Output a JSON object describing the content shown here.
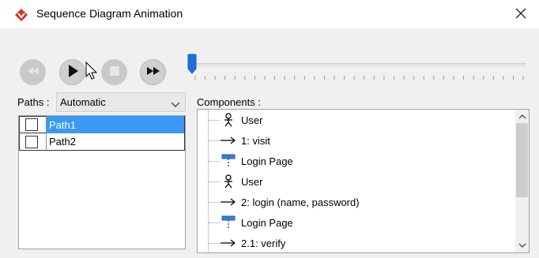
{
  "window": {
    "title": "Sequence Diagram Animation",
    "app_icon": "visual-paradigm-logo",
    "close_icon": "close-icon"
  },
  "controls": {
    "rewind": {
      "icon": "rewind-icon",
      "enabled": false
    },
    "play": {
      "icon": "play-icon",
      "enabled": true
    },
    "stop": {
      "icon": "stop-icon",
      "enabled": false
    },
    "fast_forward": {
      "icon": "fast-forward-icon",
      "enabled": true
    }
  },
  "timeline": {
    "position": 0.0,
    "tick_count": 34
  },
  "paths": {
    "label": "Paths :",
    "selected": "Automatic",
    "items": [
      {
        "label": "Path1",
        "checked": false,
        "selected": true
      },
      {
        "label": "Path2",
        "checked": false,
        "selected": false
      }
    ]
  },
  "components": {
    "label": "Components :",
    "items": [
      {
        "type": "actor",
        "icon": "actor-icon",
        "label": "User"
      },
      {
        "type": "message",
        "icon": "message-arrow-icon",
        "label": "1: visit"
      },
      {
        "type": "lifeline",
        "icon": "lifeline-icon",
        "label": "Login Page"
      },
      {
        "type": "actor",
        "icon": "actor-icon",
        "label": "User"
      },
      {
        "type": "message",
        "icon": "message-arrow-icon",
        "label": "2: login (name, password)"
      },
      {
        "type": "lifeline",
        "icon": "lifeline-icon",
        "label": "Login Page"
      },
      {
        "type": "message",
        "icon": "message-arrow-icon",
        "label": "2.1: verify"
      }
    ]
  },
  "colors": {
    "accent": "#3a99f5",
    "slider_thumb": "#1e6fd9",
    "logo": "#d6332b"
  }
}
